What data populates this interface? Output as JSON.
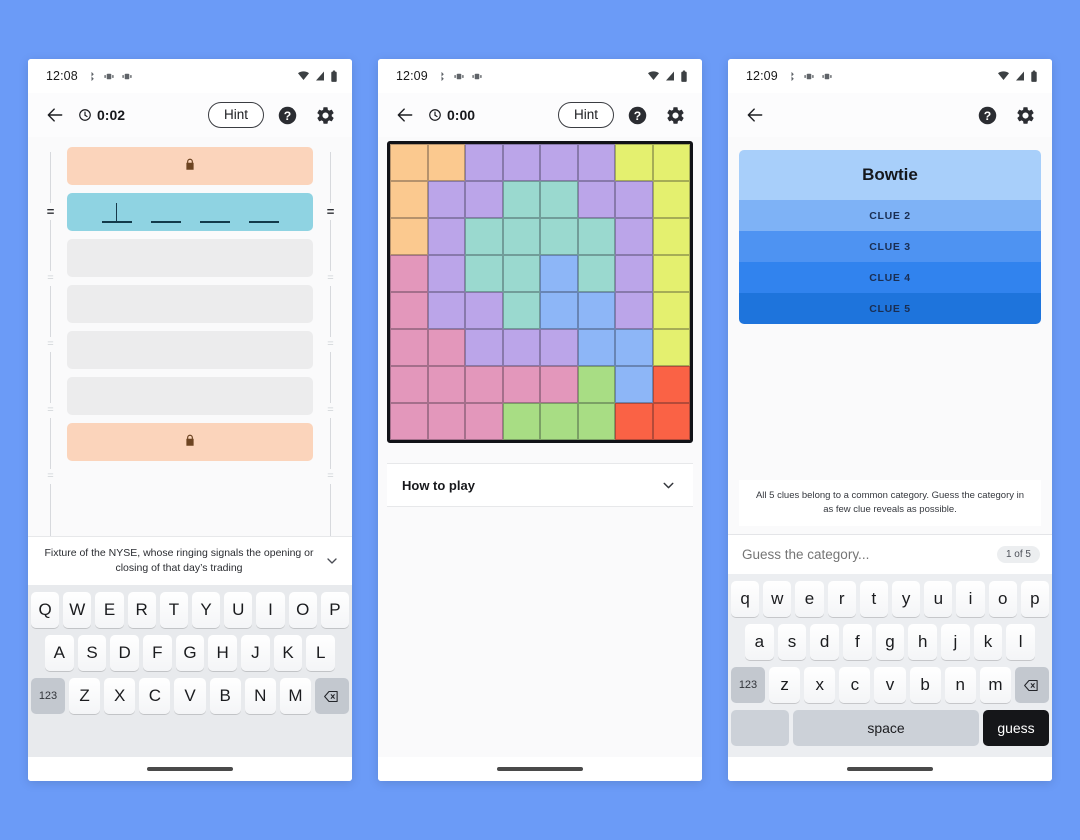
{
  "theme": {
    "background": "#6b9bf7",
    "locked_row": "#fbd4bb",
    "active_row": "#8fd3e2",
    "empty_row": "#ececed"
  },
  "phone1": {
    "status": {
      "time": "12:08",
      "icons": [
        "bluetooth-icon",
        "vibrate-icon",
        "alarm-icon",
        "wifi-icon",
        "signal-icon",
        "battery-icon"
      ]
    },
    "appbar": {
      "back": "back-arrow-icon",
      "timer": "0:02",
      "hint_label": "Hint",
      "help": "help-icon",
      "settings": "gear-icon"
    },
    "rail": {
      "top_mark": "=",
      "marks": [
        "=",
        "=",
        "=",
        "=",
        "="
      ]
    },
    "rows": [
      {
        "type": "locked",
        "glyph": "lock-icon"
      },
      {
        "type": "active",
        "blanks": 4
      },
      {
        "type": "empty"
      },
      {
        "type": "empty"
      },
      {
        "type": "empty"
      },
      {
        "type": "empty"
      },
      {
        "type": "locked",
        "glyph": "lock-icon"
      }
    ],
    "clue": "Fixture of the NYSE, whose ringing signals the opening or closing of that day’s trading",
    "clue_chevron": "chevron-down-icon",
    "keyboard": {
      "row1": [
        "Q",
        "W",
        "E",
        "R",
        "T",
        "Y",
        "U",
        "I",
        "O",
        "P"
      ],
      "row2": [
        "A",
        "S",
        "D",
        "F",
        "G",
        "H",
        "J",
        "K",
        "L"
      ],
      "numkey": "123",
      "row3": [
        "Z",
        "X",
        "C",
        "V",
        "B",
        "N",
        "M"
      ],
      "backspace": "backspace-icon"
    }
  },
  "phone2": {
    "status": {
      "time": "12:09"
    },
    "appbar": {
      "timer": "0:00",
      "hint_label": "Hint"
    },
    "howto_label": "How to play",
    "howto_chevron": "chevron-down-icon",
    "grid": {
      "rows": 8,
      "cols": 8,
      "palette": {
        "orange": "#fbc98f",
        "purple": "#bba5e9",
        "yellow": "#e4f06f",
        "teal": "#9ad9cf",
        "pink": "#e397bb",
        "blue": "#8db6f7",
        "green": "#a8dd84",
        "red": "#fa6245"
      },
      "cells": [
        [
          "orange",
          "orange",
          "purple",
          "purple",
          "purple",
          "purple",
          "yellow",
          "yellow"
        ],
        [
          "orange",
          "purple",
          "purple",
          "teal",
          "teal",
          "purple",
          "purple",
          "yellow"
        ],
        [
          "orange",
          "purple",
          "teal",
          "teal",
          "teal",
          "teal",
          "purple",
          "yellow"
        ],
        [
          "pink",
          "purple",
          "teal",
          "teal",
          "blue",
          "teal",
          "purple",
          "yellow"
        ],
        [
          "pink",
          "purple",
          "purple",
          "teal",
          "blue",
          "blue",
          "purple",
          "yellow"
        ],
        [
          "pink",
          "pink",
          "purple",
          "purple",
          "purple",
          "blue",
          "blue",
          "yellow"
        ],
        [
          "pink",
          "pink",
          "pink",
          "pink",
          "pink",
          "green",
          "blue",
          "red"
        ],
        [
          "pink",
          "pink",
          "pink",
          "green",
          "green",
          "green",
          "red",
          "red"
        ]
      ]
    }
  },
  "phone3": {
    "status": {
      "time": "12:09"
    },
    "appbar": {
      "back": "back-arrow-icon",
      "help": "help-icon",
      "settings": "gear-icon"
    },
    "clues": [
      {
        "label": "Bowtie",
        "color": "#a8cffa",
        "revealed": true
      },
      {
        "label": "CLUE 2",
        "color": "#7eb2f6",
        "revealed": false
      },
      {
        "label": "CLUE 3",
        "color": "#4e93f2",
        "revealed": false
      },
      {
        "label": "CLUE 4",
        "color": "#3183ee",
        "revealed": false
      },
      {
        "label": "CLUE 5",
        "color": "#1e74dc",
        "revealed": false
      }
    ],
    "instructions": "All 5 clues belong to a common category. Guess the category in as few clue reveals as possible.",
    "guess": {
      "placeholder": "Guess the category...",
      "value": "",
      "counter": "1 of 5"
    },
    "keyboard": {
      "row1": [
        "q",
        "w",
        "e",
        "r",
        "t",
        "y",
        "u",
        "i",
        "o",
        "p"
      ],
      "row2": [
        "a",
        "s",
        "d",
        "f",
        "g",
        "h",
        "j",
        "k",
        "l"
      ],
      "numkey": "123",
      "row3": [
        "z",
        "x",
        "c",
        "v",
        "b",
        "n",
        "m"
      ],
      "backspace": "backspace-icon",
      "space_label": "space",
      "action_label": "guess"
    }
  }
}
